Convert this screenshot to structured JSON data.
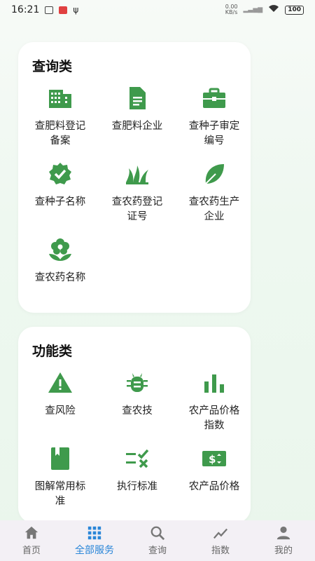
{
  "status": {
    "time": "16:21",
    "net_speed_top": "0.00",
    "net_speed_bottom": "KB/s",
    "battery": "100"
  },
  "colors": {
    "icon_green": "#3f9a4c",
    "tab_active": "#2a86d8",
    "tab_inactive": "#777777"
  },
  "query_section": {
    "title": "查询类",
    "items": [
      {
        "label": "查肥料登记备案",
        "icon": "building-icon"
      },
      {
        "label": "查肥料企业",
        "icon": "document-icon"
      },
      {
        "label": "查种子审定编号",
        "icon": "briefcase-icon"
      },
      {
        "label": "查种子名称",
        "icon": "verified-badge-icon"
      },
      {
        "label": "查农药登记证号",
        "icon": "grass-icon"
      },
      {
        "label": "查农药生产企业",
        "icon": "leaf-icon"
      },
      {
        "label": "查农药名称",
        "icon": "flower-icon"
      }
    ]
  },
  "function_section": {
    "title": "功能类",
    "items": [
      {
        "label": "查风险",
        "icon": "warning-icon"
      },
      {
        "label": "查农技",
        "icon": "bug-icon"
      },
      {
        "label": "农产品价格指数",
        "icon": "bar-chart-icon"
      },
      {
        "label": "图解常用标准",
        "icon": "book-icon"
      },
      {
        "label": "执行标准",
        "icon": "checklist-icon"
      },
      {
        "label": "农产品价格",
        "icon": "price-tag-icon"
      }
    ]
  },
  "tabs": [
    {
      "label": "首页",
      "icon": "home-icon",
      "active": false
    },
    {
      "label": "全部服务",
      "icon": "grid-icon",
      "active": true
    },
    {
      "label": "查询",
      "icon": "search-icon",
      "active": false
    },
    {
      "label": "指数",
      "icon": "trend-icon",
      "active": false
    },
    {
      "label": "我的",
      "icon": "person-icon",
      "active": false
    }
  ]
}
